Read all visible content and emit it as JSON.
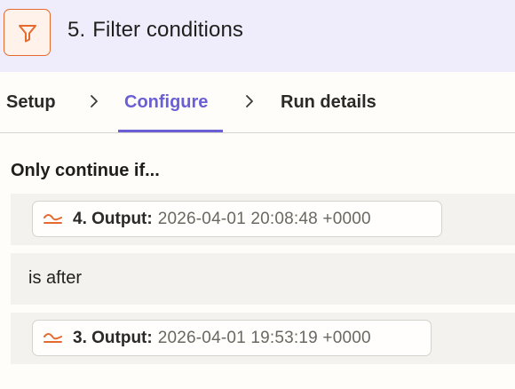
{
  "header": {
    "step_number": "5.",
    "title": "Filter conditions",
    "icon": "filter-icon",
    "accent_color": "#e56a2e"
  },
  "tabs": [
    {
      "label": "Setup",
      "active": false
    },
    {
      "label": "Configure",
      "active": true
    },
    {
      "label": "Run details",
      "active": false
    }
  ],
  "tab_accent_color": "#6a5fd4",
  "condition": {
    "intro": "Only continue if...",
    "left_operand": {
      "icon": "formatter-icon",
      "label": "4. Output:",
      "value": "2026-04-01 20:08:48 +0000"
    },
    "operator": "is after",
    "right_operand": {
      "icon": "formatter-icon",
      "label": "3. Output:",
      "value": "2026-04-01 19:53:19 +0000"
    }
  }
}
